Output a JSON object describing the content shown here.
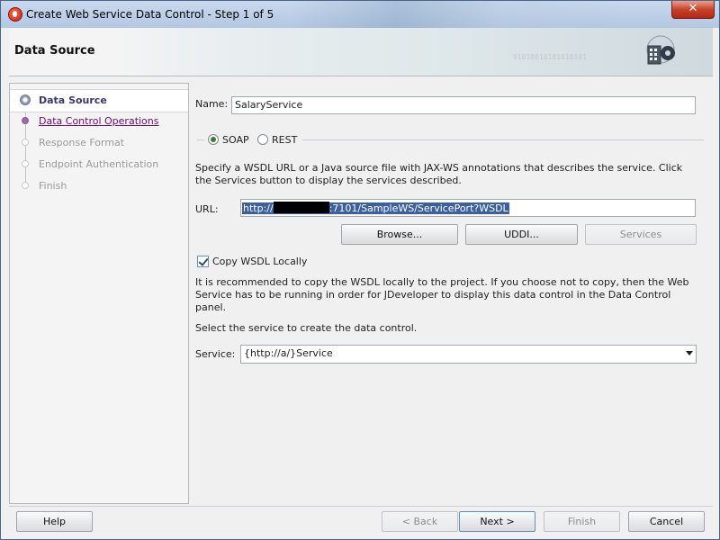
{
  "window": {
    "title": "Create Web Service Data Control - Step 1 of 5",
    "close_glyph": "✕",
    "banner_title": "Data Source",
    "banner_bits": "01010010101010101"
  },
  "nav": {
    "items": [
      {
        "label": "Data Source",
        "state": "active"
      },
      {
        "label": "Data Control Operations",
        "state": "link"
      },
      {
        "label": "Response Format",
        "state": "disabled"
      },
      {
        "label": "Endpoint Authentication",
        "state": "disabled"
      },
      {
        "label": "Finish",
        "state": "disabled"
      }
    ]
  },
  "form": {
    "name_label": "Name:",
    "name_value": "SalaryService",
    "soap_label": "SOAP",
    "rest_label": "REST",
    "description": "Specify a WSDL URL or a Java source file with JAX-WS annotations that describes the service. Click the Services button to display the services described.",
    "url_label": "URL:",
    "url_prefix": "http://",
    "url_suffix": ":7101/SampleWS/ServicePort?WSDL",
    "browse_label": "Browse...",
    "uddi_label": "UDDI...",
    "services_label": "Services",
    "copy_wsdl_label": "Copy WSDL Locally",
    "copy_note": "It is recommended to copy the WSDL locally to the project. If you choose not to copy, then the Web Service has to be running in order for JDeveloper to display this data control in the Data Control panel.",
    "select_service_text": "Select the service to create the data control.",
    "service_label": "Service:",
    "service_value": "{http://a/}Service"
  },
  "footer": {
    "help": "Help",
    "back": "< Back",
    "next": "Next >",
    "finish": "Finish",
    "cancel": "Cancel"
  },
  "colors": {
    "accent_selection": "#3c5fa0",
    "link": "#700a70",
    "close_button": "#c7432c"
  }
}
